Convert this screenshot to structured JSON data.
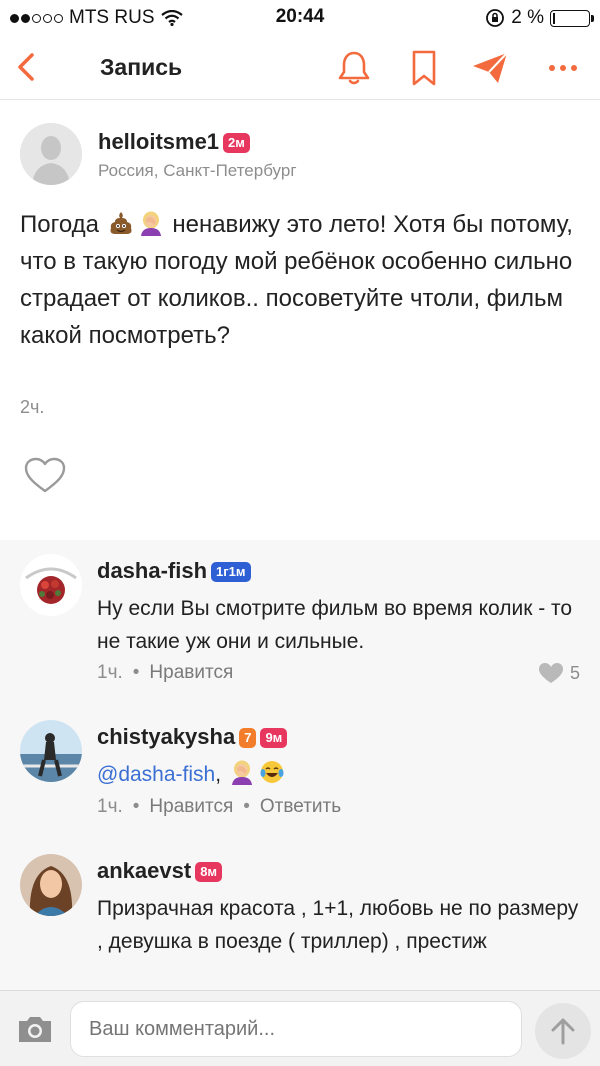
{
  "status_bar": {
    "carrier": "MTS RUS",
    "time": "20:44",
    "battery": "2 %",
    "battery_level": 0.02
  },
  "nav": {
    "title": "Запись",
    "accent_color": "#f26a3d"
  },
  "post": {
    "username": "helloitsme1",
    "badge": "2м",
    "location": "Россия, Санкт-Петербург",
    "text_before_emoji": "Погода",
    "text_after_emoji": "ненавижу это лето! Хотя бы потому, что в такую погоду мой ребёнок особенно сильно страдает от коликов.. посоветуйте чтоли, фильм какой посмотреть?",
    "time": "2ч."
  },
  "comments": [
    {
      "username": "dasha-fish",
      "badge": "1г1м",
      "text": "Ну если Вы смотрите фильм во время колик - то не такие уж они и сильные.",
      "time": "1ч.",
      "like_label": "Нравится",
      "likes": "5"
    },
    {
      "username": "chistyakysha",
      "badge_level": "7",
      "badge": "9м",
      "mention": "@dasha-fish",
      "text_after": ",",
      "time": "1ч.",
      "like_label": "Нравится",
      "reply_label": "Ответить"
    },
    {
      "username": "ankaevst",
      "badge": "8м",
      "text": "Призрачная красота , 1+1, любовь не по размеру , девушка в поезде ( триллер) , престиж"
    }
  ],
  "input": {
    "placeholder": "Ваш комментарий..."
  },
  "colors": {
    "badge_pink": "#e8375f",
    "badge_blue": "#2f5fd4",
    "badge_orange": "#f27d2a",
    "mention": "#3b6fd3"
  }
}
